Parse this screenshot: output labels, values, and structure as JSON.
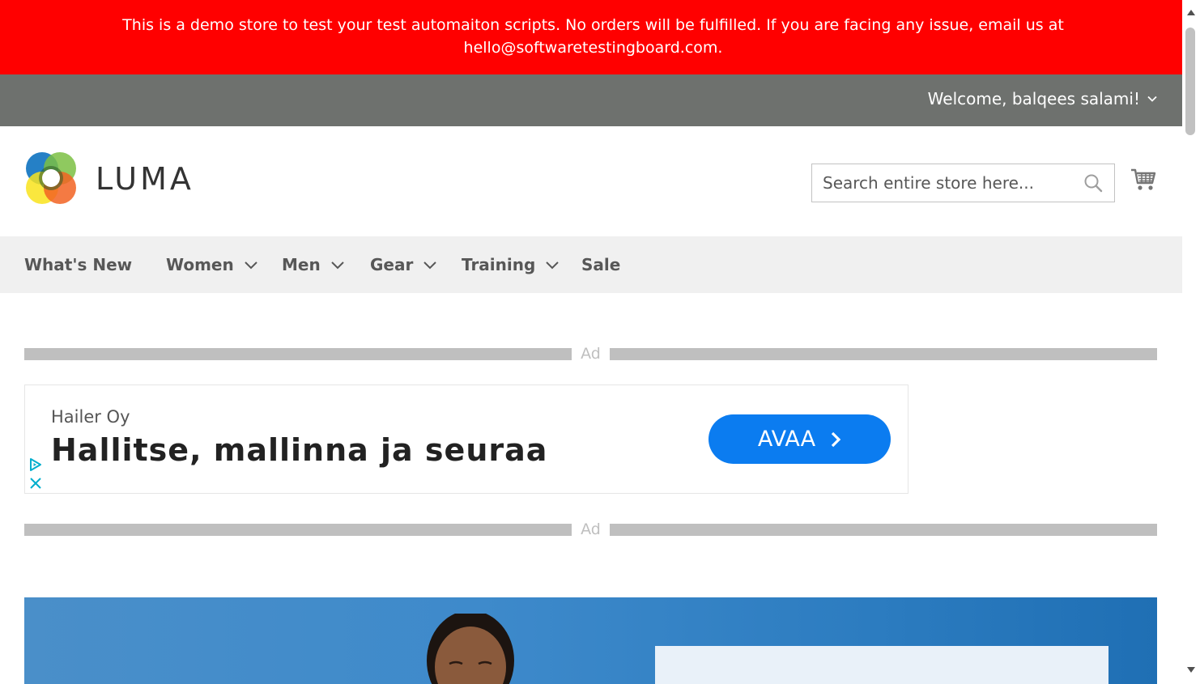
{
  "banner": {
    "line1": "This is a demo store to test your test automaiton scripts. No orders will be fulfilled. If you are facing any issue, email us at",
    "line2": "hello@softwaretestingboard.com."
  },
  "header": {
    "welcome": "Welcome, balqees salami!"
  },
  "logo": {
    "text": "LUMA"
  },
  "search": {
    "placeholder": "Search entire store here..."
  },
  "nav": {
    "items": [
      {
        "label": "What's New"
      },
      {
        "label": "Women"
      },
      {
        "label": "Men"
      },
      {
        "label": "Gear"
      },
      {
        "label": "Training"
      },
      {
        "label": "Sale"
      }
    ]
  },
  "ad": {
    "label_top": "Ad",
    "label_bottom": "Ad",
    "advertiser": "Hailer Oy",
    "headline": "Hallitse, mallinna ja seuraa",
    "cta": "AVAA"
  },
  "colors": {
    "banner_bg": "#ff0000",
    "header_bg": "#6e716e",
    "nav_bg": "#f0f0f0",
    "cta_bg": "#0b7cf0"
  },
  "icons": {
    "search": "search-icon",
    "cart": "cart-icon",
    "chevron": "chevron-down-icon",
    "adchoices": "adchoices-icon",
    "close": "close-icon"
  }
}
